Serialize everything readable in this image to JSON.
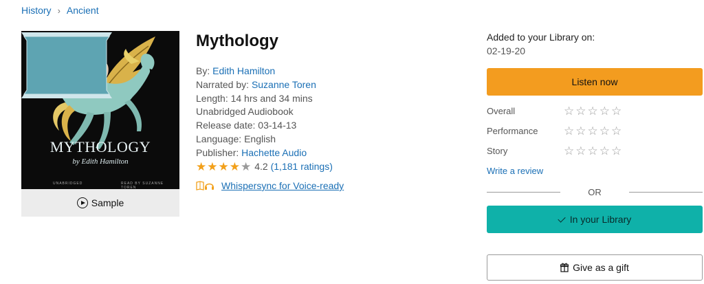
{
  "breadcrumb": {
    "items": [
      "History",
      "Ancient"
    ]
  },
  "cover": {
    "title": "MYTHOLOGY",
    "author": "by Edith Hamilton",
    "footer_left": "UNABRIDGED",
    "footer_right": "READ BY SUZANNE TOREN"
  },
  "sample": {
    "label": "Sample"
  },
  "book": {
    "title": "Mythology",
    "author_prefix": "By: ",
    "author": "Edith Hamilton",
    "narrator_prefix": "Narrated by: ",
    "narrator": "Suzanne Toren",
    "length": "Length: 14 hrs and 34 mins",
    "format": "Unabridged Audiobook",
    "release_date": "Release date: 03-14-13",
    "language": "Language: English",
    "publisher_prefix": "Publisher: ",
    "publisher": "Hachette Audio",
    "rating_value": "4.2",
    "rating_count": "(1,181 ratings)",
    "rating_stars": 4,
    "whispersync": "Whispersync for Voice-ready"
  },
  "library": {
    "added_label": "Added to your Library on:",
    "added_date": "02-19-20",
    "listen_button": "Listen now",
    "ratings": [
      {
        "label": "Overall"
      },
      {
        "label": "Performance"
      },
      {
        "label": "Story"
      }
    ],
    "write_review": "Write a review",
    "or_text": "OR",
    "in_library_button": "In your Library",
    "gift_button": "Give as a gift"
  },
  "colors": {
    "accent_orange": "#f39c1f",
    "accent_teal": "#0fb1a9",
    "link_blue": "#1a6fb5",
    "star_gold": "#f2a01a"
  }
}
